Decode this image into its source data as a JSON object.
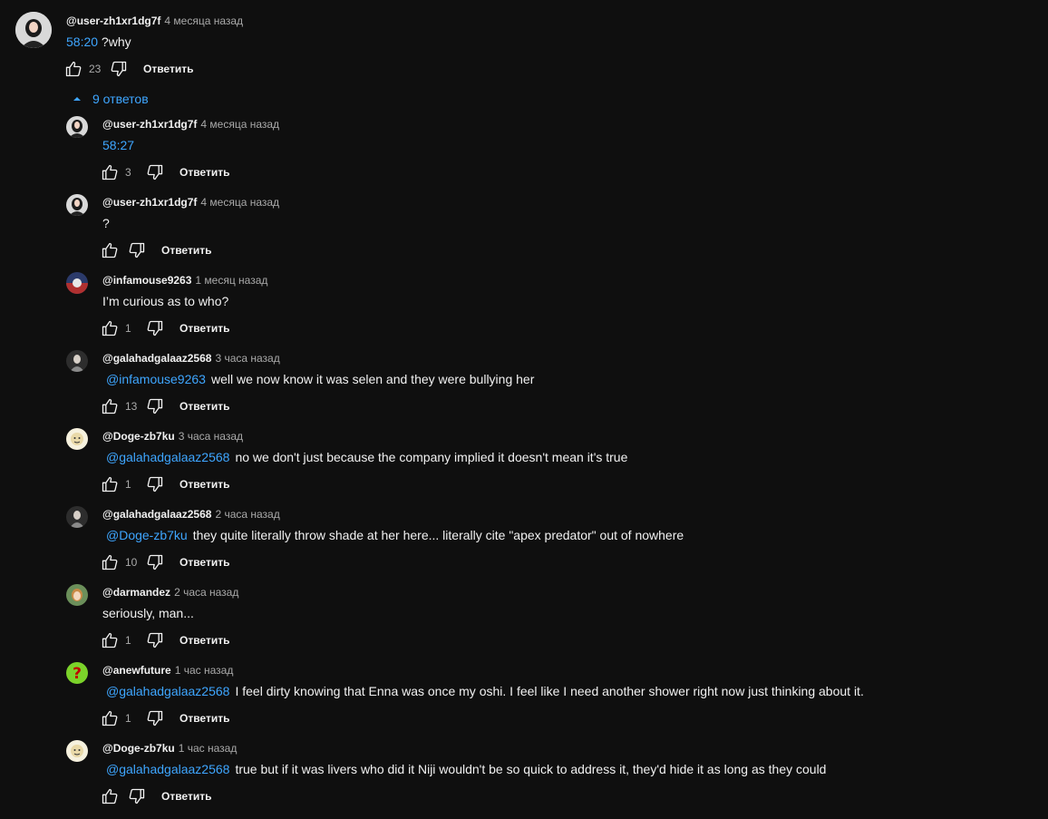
{
  "top_comment": {
    "author": "@user-zh1xr1dg7f",
    "time": "4 месяца назад",
    "timestamp_link": "58:20",
    "text": " ?why",
    "likes": "23",
    "reply_label": "Ответить"
  },
  "replies_toggle": {
    "label": "9 ответов"
  },
  "replies": [
    {
      "author": "@user-zh1xr1dg7f",
      "time": "4 месяца назад",
      "mention": "",
      "timestamp_link": "58:27",
      "text": "",
      "likes": "3",
      "reply_label": "Ответить"
    },
    {
      "author": "@user-zh1xr1dg7f",
      "time": "4 месяца назад",
      "mention": "",
      "timestamp_link": "",
      "text": "?",
      "likes": "",
      "reply_label": "Ответить"
    },
    {
      "author": "@infamouse9263",
      "time": "1 месяц назад",
      "mention": "",
      "timestamp_link": "",
      "text": "I’m curious as to who?",
      "likes": "1",
      "reply_label": "Ответить"
    },
    {
      "author": "@galahadgalaaz2568",
      "time": "3 часа назад",
      "mention": "@infamouse9263",
      "timestamp_link": "",
      "text": "well we now know it was selen and they were bullying her",
      "likes": "13",
      "reply_label": "Ответить"
    },
    {
      "author": "@Doge-zb7ku",
      "time": "3 часа назад",
      "mention": "@galahadgalaaz2568",
      "timestamp_link": "",
      "text": "no we don't just because the company implied it doesn't mean it's true",
      "likes": "1",
      "reply_label": "Ответить"
    },
    {
      "author": "@galahadgalaaz2568",
      "time": "2 часа назад",
      "mention": "@Doge-zb7ku",
      "timestamp_link": "",
      "text": "they quite literally throw shade at her here... literally cite \"apex predator\" out of nowhere",
      "likes": "10",
      "reply_label": "Ответить"
    },
    {
      "author": "@darmandez",
      "time": "2 часа назад",
      "mention": "",
      "timestamp_link": "",
      "text": "seriously, man...",
      "likes": "1",
      "reply_label": "Ответить"
    },
    {
      "author": "@anewfuture",
      "time": "1 час назад",
      "mention": "@galahadgalaaz2568",
      "timestamp_link": "",
      "text": "I feel dirty knowing that Enna was once my oshi. I feel like I need another shower right now just thinking about it.",
      "likes": "1",
      "reply_label": "Ответить"
    },
    {
      "author": "@Doge-zb7ku",
      "time": "1 час назад",
      "mention": "@galahadgalaaz2568",
      "timestamp_link": "",
      "text": "true but if it was livers who did it Niji wouldn't be so quick to address it, they'd hide it as long as they could",
      "likes": "",
      "reply_label": "Ответить"
    }
  ],
  "icons": {
    "like": "thumb-up-icon",
    "dislike": "thumb-down-icon",
    "toggle": "caret-up-icon"
  },
  "colors": {
    "background": "#0f0f0f",
    "link": "#3ea6ff",
    "secondary_text": "#aaaaaa"
  }
}
